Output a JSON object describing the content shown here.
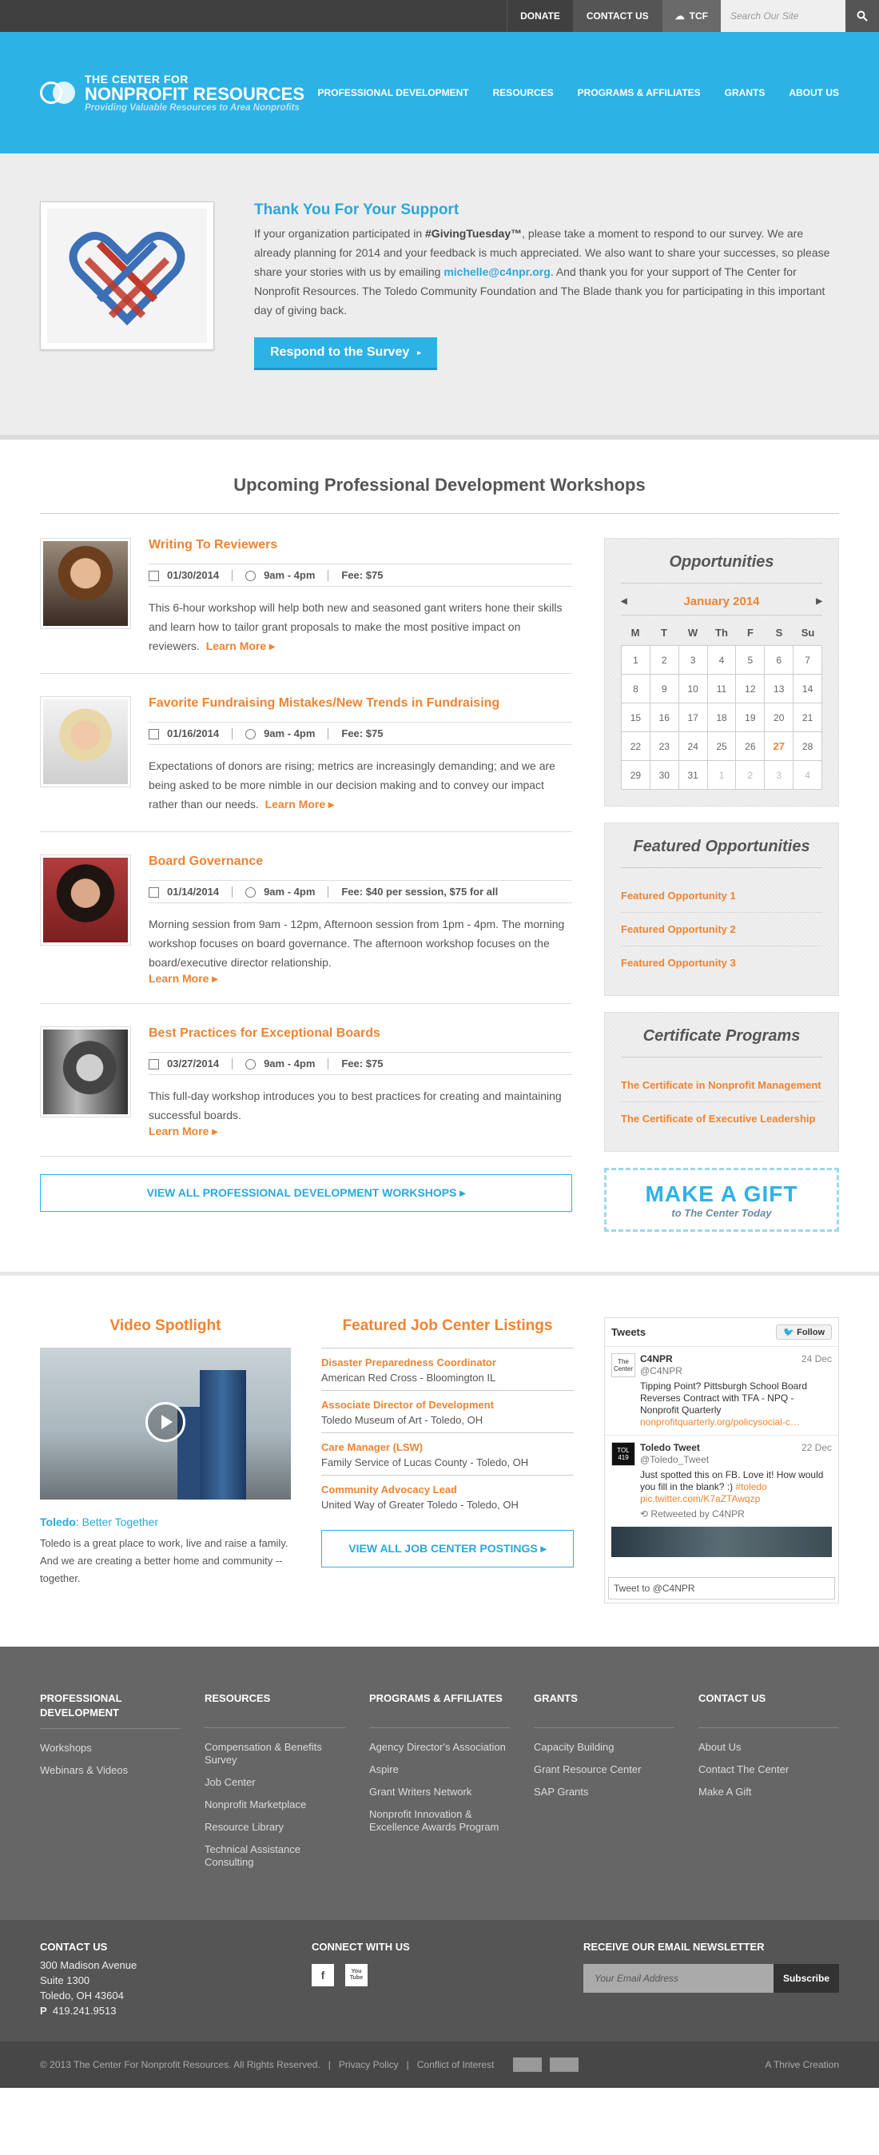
{
  "utility": {
    "donate": "DONATE",
    "contact": "CONTACT US",
    "tcf": "TCF",
    "search_placeholder": "Search Our Site"
  },
  "logo": {
    "line1": "THE CENTER FOR",
    "line2": "NONPROFIT RESOURCES",
    "tagline": "Providing Valuable Resources to Area Nonprofits"
  },
  "nav": [
    "PROFESSIONAL DEVELOPMENT",
    "RESOURCES",
    "PROGRAMS & AFFILIATES",
    "GRANTS",
    "ABOUT US"
  ],
  "promo": {
    "title": "Thank You For Your Support",
    "text_before": "If your organization participated in ",
    "hashtag": "#GivingTuesday™",
    "text_mid": ", please take a moment to respond to our survey.  We are already planning for 2014 and your feedback is much appreciated. We also want to share your successes, so please share your stories with us by emailing ",
    "email": "michelle@c4npr.org",
    "text_after": ". And thank you for your support of The Center for Nonprofit Resources. The Toledo Community Foundation and The Blade thank you for participating in this important day of giving back.",
    "button": "Respond to the Survey"
  },
  "workshops": {
    "title": "Upcoming Professional Development Workshops",
    "items": [
      {
        "title": "Writing To Reviewers",
        "date": "01/30/2014",
        "time": "9am - 4pm",
        "fee": "Fee: $75",
        "desc": "This 6-hour workshop will help both new and seasoned gant writers hone their skills and learn how to tailor grant proposals to make the most positive impact on reviewers.",
        "learn": "Learn More"
      },
      {
        "title": "Favorite Fundraising Mistakes/New Trends in Fundraising",
        "date": "01/16/2014",
        "time": "9am - 4pm",
        "fee": "Fee: $75",
        "desc": "Expectations of donors are rising; metrics are increasingly demanding; and we are being asked to be more nimble in our decision making and to convey our impact rather than our needs.",
        "learn": "Learn More"
      },
      {
        "title": "Board Governance",
        "date": "01/14/2014",
        "time": "9am - 4pm",
        "fee": "Fee: $40 per session, $75 for all",
        "desc": "Morning session from 9am - 12pm, Afternoon session from 1pm - 4pm. The morning workshop focuses on board governance. The afternoon workshop focuses on the board/executive director relationship.",
        "learn": "Learn More"
      },
      {
        "title": "Best Practices for Exceptional Boards",
        "date": "03/27/2014",
        "time": "9am - 4pm",
        "fee": "Fee: $75",
        "desc": "This full-day workshop introduces you to best practices for creating and maintaining successful boards.",
        "learn": "Learn More"
      }
    ],
    "view_all": "VIEW ALL PROFESSIONAL DEVELOPMENT WORKSHOPS"
  },
  "opportunities": {
    "title": "Opportunities",
    "month": "January 2014",
    "days": [
      "M",
      "T",
      "W",
      "Th",
      "F",
      "S",
      "Su"
    ],
    "cells": [
      "1",
      "2",
      "3",
      "4",
      "5",
      "6",
      "7",
      "8",
      "9",
      "10",
      "11",
      "12",
      "13",
      "14",
      "15",
      "16",
      "17",
      "18",
      "19",
      "20",
      "21",
      "22",
      "23",
      "24",
      "25",
      "26",
      "27",
      "28",
      "29",
      "30",
      "31",
      "1",
      "2",
      "3",
      "4"
    ]
  },
  "featured": {
    "title": "Featured Opportunities",
    "items": [
      "Featured Opportunity 1",
      "Featured Opportunity 2",
      "Featured Opportunity 3"
    ]
  },
  "certificates": {
    "title": "Certificate Programs",
    "items": [
      "The Certificate in Nonprofit Management",
      "The Certificate of Executive Leadership"
    ]
  },
  "gift": {
    "line1": "MAKE A GIFT",
    "line2": "to The Center Today"
  },
  "video": {
    "title": "Video Spotlight",
    "caption_bold": "Toledo",
    "caption_rest": ": Better Together",
    "desc": "Toledo is a great place to work, live and raise a family. And we are creating a better home and community -- together."
  },
  "jobs": {
    "title": "Featured Job Center Listings",
    "items": [
      {
        "title": "Disaster Preparedness Coordinator",
        "org": "American Red Cross - Bloomington IL"
      },
      {
        "title": "Associate Director of Development",
        "org": "Toledo Museum of Art - Toledo, OH"
      },
      {
        "title": "Care Manager (LSW)",
        "org": "Family Service of Lucas County - Toledo, OH"
      },
      {
        "title": "Community Advocacy Lead",
        "org": "United Way of Greater Toledo - Toledo, OH"
      }
    ],
    "view_all": "VIEW ALL JOB CENTER POSTINGS"
  },
  "tweets": {
    "header": "Tweets",
    "follow": "Follow",
    "t1": {
      "avatar": "The Center",
      "name": "C4NPR",
      "handle": "@C4NPR",
      "date": "24 Dec",
      "text": "Tipping Point? Pittsburgh School Board Reverses Contract with TFA - NPQ - Nonprofit Quarterly",
      "link": "nonprofitquarterly.org/policysocial-c…"
    },
    "t2": {
      "avatar": "TOL 419",
      "name": "Toledo Tweet",
      "handle": "@Toledo_Tweet",
      "date": "22 Dec",
      "text_before": "Just spotted this on FB. Love it! How would you fill in the blank? :) ",
      "hashtag": "#toledo",
      "link": "pic.twitter.com/K7aZTAwqzp",
      "rt": "Retweeted by C4NPR"
    },
    "input": "Tweet to @C4NPR"
  },
  "footer": {
    "cols": [
      {
        "title": "PROFESSIONAL DEVELOPMENT",
        "links": [
          "Workshops",
          "Webinars & Videos"
        ]
      },
      {
        "title": "RESOURCES",
        "links": [
          "Compensation & Benefits Survey",
          "Job Center",
          "Nonprofit Marketplace",
          "Resource Library",
          "Technical Assistance Consulting"
        ]
      },
      {
        "title": "PROGRAMS & AFFILIATES",
        "links": [
          "Agency Director's Association",
          "Aspire",
          "Grant Writers Network",
          "Nonprofit Innovation & Excellence Awards Program"
        ]
      },
      {
        "title": "GRANTS",
        "links": [
          "Capacity Building",
          "Grant Resource Center",
          "SAP Grants"
        ]
      },
      {
        "title": "CONTACT US",
        "links": [
          "About Us",
          "Contact The Center",
          "Make A Gift"
        ]
      }
    ]
  },
  "footer2": {
    "contact_title": "CONTACT US",
    "addr1": "300 Madison Avenue",
    "addr2": "Suite 1300",
    "addr3": "Toledo, OH 43604",
    "phone_label": "P",
    "phone": "419.241.9513",
    "connect_title": "CONNECT WITH US",
    "fb": "f",
    "yt": "You Tube",
    "newsletter_title": "RECEIVE OUR EMAIL NEWSLETTER",
    "newsletter_placeholder": "Your Email Address",
    "subscribe": "Subscribe"
  },
  "bottom": {
    "copyright": "© 2013 The Center For Nonprofit Resources. All Rights Reserved.",
    "privacy": "Privacy Policy",
    "conflict": "Conflict of Interest",
    "credit": "A Thrive Creation"
  },
  "colors": {
    "blue": "#2db2e6",
    "orange": "#ee8432",
    "footer": "#666666"
  }
}
